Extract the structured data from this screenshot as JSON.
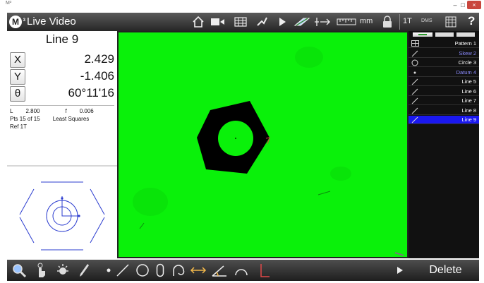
{
  "window": {
    "app_tag": "M³",
    "minimize_glyph": "–",
    "maximize_glyph": "□",
    "close_glyph": "×"
  },
  "toolbar": {
    "logo_letter": "M",
    "logo_sup": "3",
    "title": "Live Video",
    "units": "mm",
    "tolerance_mode": "1T",
    "angle_format": "DMS",
    "help": "?",
    "icons": [
      "home-icon",
      "record-video-icon",
      "grid-icon",
      "probe-icon",
      "play-icon",
      "edge-tool-icon",
      "crosshair-arrow-icon",
      "ruler-icon",
      "lock-icon",
      "calculator-icon"
    ]
  },
  "readout": {
    "feature_name": "Line 9",
    "rows": [
      {
        "axis": "X",
        "value": "2.429"
      },
      {
        "axis": "Y",
        "value": "-1.406"
      },
      {
        "axis": "θ",
        "value": "60°11'16"
      }
    ],
    "info": [
      {
        "label": "L",
        "value": "2.800",
        "label2": "f",
        "value2": "0.006"
      },
      {
        "label": "Pts 15 of 15",
        "value": "",
        "label2": "Least Squares",
        "value2": ""
      },
      {
        "label": "Ref 1T",
        "value": "",
        "label2": "",
        "value2": ""
      }
    ]
  },
  "feature_list": {
    "items": [
      {
        "icon": "pattern-icon",
        "label": "Pattern 1",
        "color": "#ffffff",
        "selected": false
      },
      {
        "icon": "line-icon",
        "label": "Skew 2",
        "color": "#8c8cff",
        "selected": false
      },
      {
        "icon": "circle-icon",
        "label": "Circle 3",
        "color": "#ffffff",
        "selected": false
      },
      {
        "icon": "point-icon",
        "label": "Datum 4",
        "color": "#8c8cff",
        "selected": false
      },
      {
        "icon": "line-icon",
        "label": "Line 5",
        "color": "#ffffff",
        "selected": false
      },
      {
        "icon": "line-icon",
        "label": "Line 6",
        "color": "#ffffff",
        "selected": false
      },
      {
        "icon": "line-icon",
        "label": "Line 7",
        "color": "#ffffff",
        "selected": false
      },
      {
        "icon": "line-icon",
        "label": "Line 8",
        "color": "#ffffff",
        "selected": false
      },
      {
        "icon": "line-icon",
        "label": "Line 9",
        "color": "#ffffff",
        "selected": true
      }
    ]
  },
  "bottom_toolbar": {
    "tools": [
      "zoom-icon",
      "hand-touch-icon",
      "light-icon",
      "probe-pen-icon",
      "point-tool-icon",
      "line-tool-icon",
      "circle-tool-icon",
      "slot-tool-icon",
      "arc-tool-icon",
      "distance-tool-icon",
      "angle-tool-icon",
      "arc-segment-icon",
      "perpendicular-icon",
      "play-icon"
    ],
    "delete_label": "Delete"
  },
  "colors": {
    "video_background": "#0af10a",
    "selected_row": "#1a18f0",
    "annotation_arrow": "#e60000"
  }
}
